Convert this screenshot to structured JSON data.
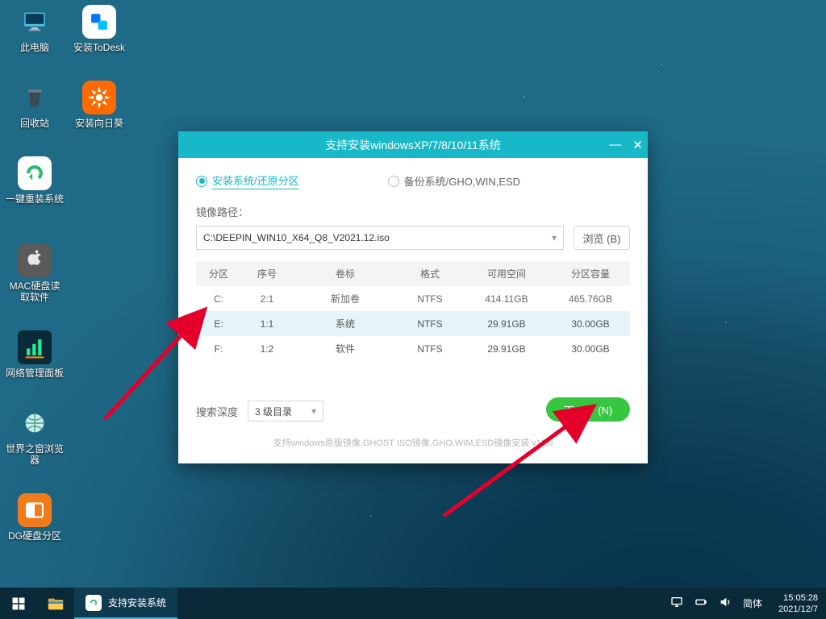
{
  "desktop_icons": [
    {
      "label": "此电脑"
    },
    {
      "label": "安装ToDesk"
    },
    {
      "label": "回收站"
    },
    {
      "label": "安装向日葵"
    },
    {
      "label": "一键重装系统"
    },
    {
      "label": "MAC硬盘读取软件"
    },
    {
      "label": "网络管理面板"
    },
    {
      "label": "世界之窗浏览器"
    },
    {
      "label": "DG硬盘分区"
    }
  ],
  "installer": {
    "title": "支持安装windowsXP/7/8/10/11系统",
    "tab_install": "安装系统/还原分区",
    "tab_backup": "备份系统/GHO,WIN,ESD",
    "path_label": "镜像路径：",
    "path_value": "C:\\DEEPIN_WIN10_X64_Q8_V2021.12.iso",
    "browse": "浏览 (B)",
    "headers": {
      "part": "分区",
      "idx": "序号",
      "vol": "卷标",
      "fmt": "格式",
      "free": "可用空间",
      "cap": "分区容量"
    },
    "rows": [
      {
        "part": "C:",
        "idx": "2:1",
        "vol": "新加卷",
        "fmt": "NTFS",
        "free": "414.11GB",
        "cap": "465.76GB"
      },
      {
        "part": "E:",
        "idx": "1:1",
        "vol": "系统",
        "fmt": "NTFS",
        "free": "29.91GB",
        "cap": "30.00GB"
      },
      {
        "part": "F:",
        "idx": "1:2",
        "vol": "软件",
        "fmt": "NTFS",
        "free": "29.91GB",
        "cap": "30.00GB"
      }
    ],
    "depth_label": "搜索深度",
    "depth_value": "3 级目录",
    "next": "下一步 (N)",
    "support": "支持windows原版镜像,GHOST ISO镜像,GHO,WIM,ESD镜像安装    v11.0"
  },
  "taskbar": {
    "task_label": "支持安装系统",
    "ime": "简体",
    "time": "15:05:28",
    "date": "2021/12/7"
  }
}
